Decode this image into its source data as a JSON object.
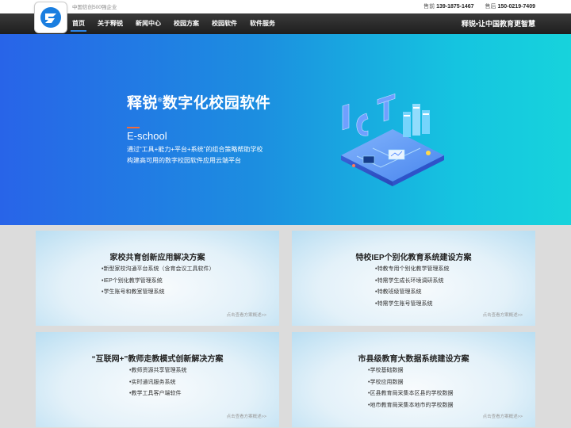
{
  "header": {
    "tagline": "中国信创500强企业",
    "presales_label": "售前",
    "presales_phone": "139-1875-1467",
    "aftersales_label": "售后",
    "aftersales_phone": "150-0219-7409"
  },
  "nav": {
    "items": [
      "首页",
      "关于释锐",
      "新闻中心",
      "校园方案",
      "校园软件",
      "软件服务"
    ],
    "active_index": 0,
    "slogan": "释锐•让中国教育更智慧"
  },
  "banner": {
    "title_brand": "释锐",
    "title_mark": "®",
    "title_rest": "数字化校园软件",
    "subtitle": "E-school",
    "desc_line1": "通过“工具+能力+平台+系统”的组合策略帮助学校",
    "desc_line2": "构建高可用的数字校园软件应用云端平台",
    "art_text": "ICT"
  },
  "cards": [
    {
      "title": "家校共育创新应用解决方案",
      "items": [
        "•新型家校沟通平台系统（含育会议工具软件）",
        "•IEP个别化教学管理系统",
        "•学生账号和教室管理系统"
      ],
      "link": "点击查看方案概述>>"
    },
    {
      "title": "特校IEP个别化教育系统建设方案",
      "items": [
        "•特教专用个别化教学管理系统",
        "•特需学生成长环境调研系统",
        "•特教班级管理系统",
        "•特需学生账号管理系统"
      ],
      "link": "点击查看方案概述>>"
    },
    {
      "title": "“互联网+”教师走教模式创新解决方案",
      "items": [
        "•教师资源共享管理系统",
        "•实时通讯服务系统",
        "•教学工具客户端软件"
      ],
      "link": "点击查看方案概述>>"
    },
    {
      "title": "市县级教育大数据系统建设方案",
      "items": [
        "•学校基础数据",
        "•学校应用数据",
        "•区县教育局采集本区县的学校数据",
        "•地市教育局采集本地市的学校数据"
      ],
      "link": "点击查看方案概述>>"
    }
  ],
  "colors": {
    "nav_active_underline": "#2f86e6",
    "banner_start": "#2864e8",
    "banner_end": "#17d3dc",
    "accent_line": "#f26b3a",
    "page_bg": "#dcdcdc"
  }
}
